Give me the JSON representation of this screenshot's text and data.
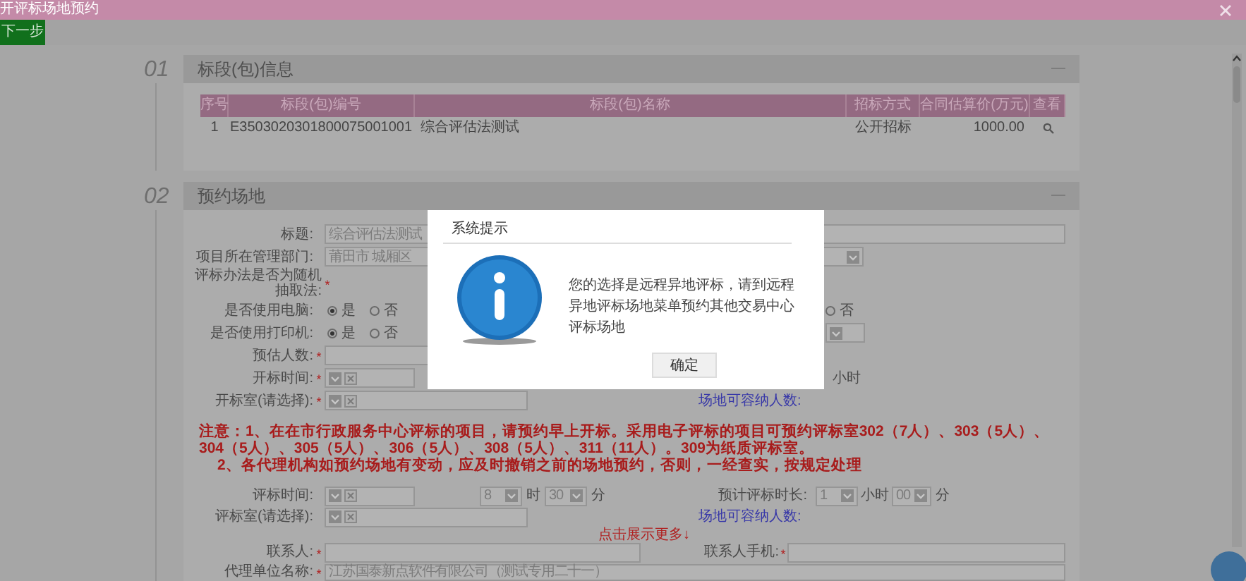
{
  "window": {
    "title": "开评标场地预约"
  },
  "toolbar": {
    "next_button": "下一步"
  },
  "lot_section": {
    "number": "01",
    "title": "标段(包)信息",
    "table": {
      "columns": [
        "序号",
        "标段(包)编号",
        "标段(包)名称",
        "招标方式",
        "合同估算价(万元)",
        "查看"
      ],
      "rows": [
        {
          "cells": [
            "1",
            "E3503020301800075001001",
            "综合评估法测试",
            "公开招标",
            "1000.00"
          ]
        }
      ]
    }
  },
  "venue_section": {
    "number": "02",
    "title": "预约场地",
    "title_field": {
      "label": "标题:",
      "value": "综合评估法测试"
    },
    "department": {
      "label": "项目所在管理部门:",
      "value": "莆田市 城厢区"
    },
    "random_method": {
      "label": "评标办法是否为随机抽取法:",
      "mark": "*"
    },
    "use_computer": {
      "label": "是否使用电脑:",
      "options": [
        {
          "label": "是",
          "selected": true
        },
        {
          "label": "否",
          "selected": false
        }
      ],
      "right_options": [
        {
          "label": "否",
          "selected": false
        }
      ]
    },
    "use_printer": {
      "label": "是否使用打印机:",
      "options": [
        {
          "label": "是",
          "selected": true
        },
        {
          "label": "否",
          "selected": false
        }
      ]
    },
    "headcount": {
      "label": "预估人数:",
      "mark": "*"
    },
    "open_time": {
      "label": "开标时间:",
      "mark": "*",
      "right_unit": "小时"
    },
    "open_room": {
      "label": "开标室(请选择):",
      "mark": "*",
      "capacity_label": "场地可容纳人数:"
    },
    "notice": [
      "注意：1、在在市行政服务中心评标的项目，请预约早上开标。采用电子评标的项目可预约评标室302（7人）、303（5人）、304（5人）、305（5人）、306（5人）、308（5人）、311（11人）。309为纸质评标室。",
      "2、各代理机构如预约场地有变动，应及时撤销之前的场地预约，否则，一经查实，按规定处理"
    ],
    "eval_time": {
      "label": "评标时间:",
      "hour": "8",
      "hour_unit": "时",
      "minute": "30",
      "minute_unit": "分",
      "duration_label": "预计评标时长:",
      "duration_hours": "1",
      "hours_unit": "小时",
      "duration_minutes": "00",
      "minutes_unit": "分"
    },
    "eval_room": {
      "label": "评标室(请选择):",
      "capacity_label": "场地可容纳人数:"
    },
    "show_more_link": "点击展示更多↓",
    "contact": {
      "label": "联系人:",
      "mark": "*"
    },
    "contact_phone": {
      "label": "联系人手机:",
      "mark": "*"
    },
    "agency": {
      "label": "代理单位名称:",
      "mark": "*",
      "value": "江苏国泰新点软件有限公司（测试专用二十一）"
    }
  },
  "dialog": {
    "title": "系统提示",
    "message": "您的选择是远程异地评标，请到远程异地评标场地菜单预约其他交易中心评标场地",
    "ok_button": "确定"
  }
}
